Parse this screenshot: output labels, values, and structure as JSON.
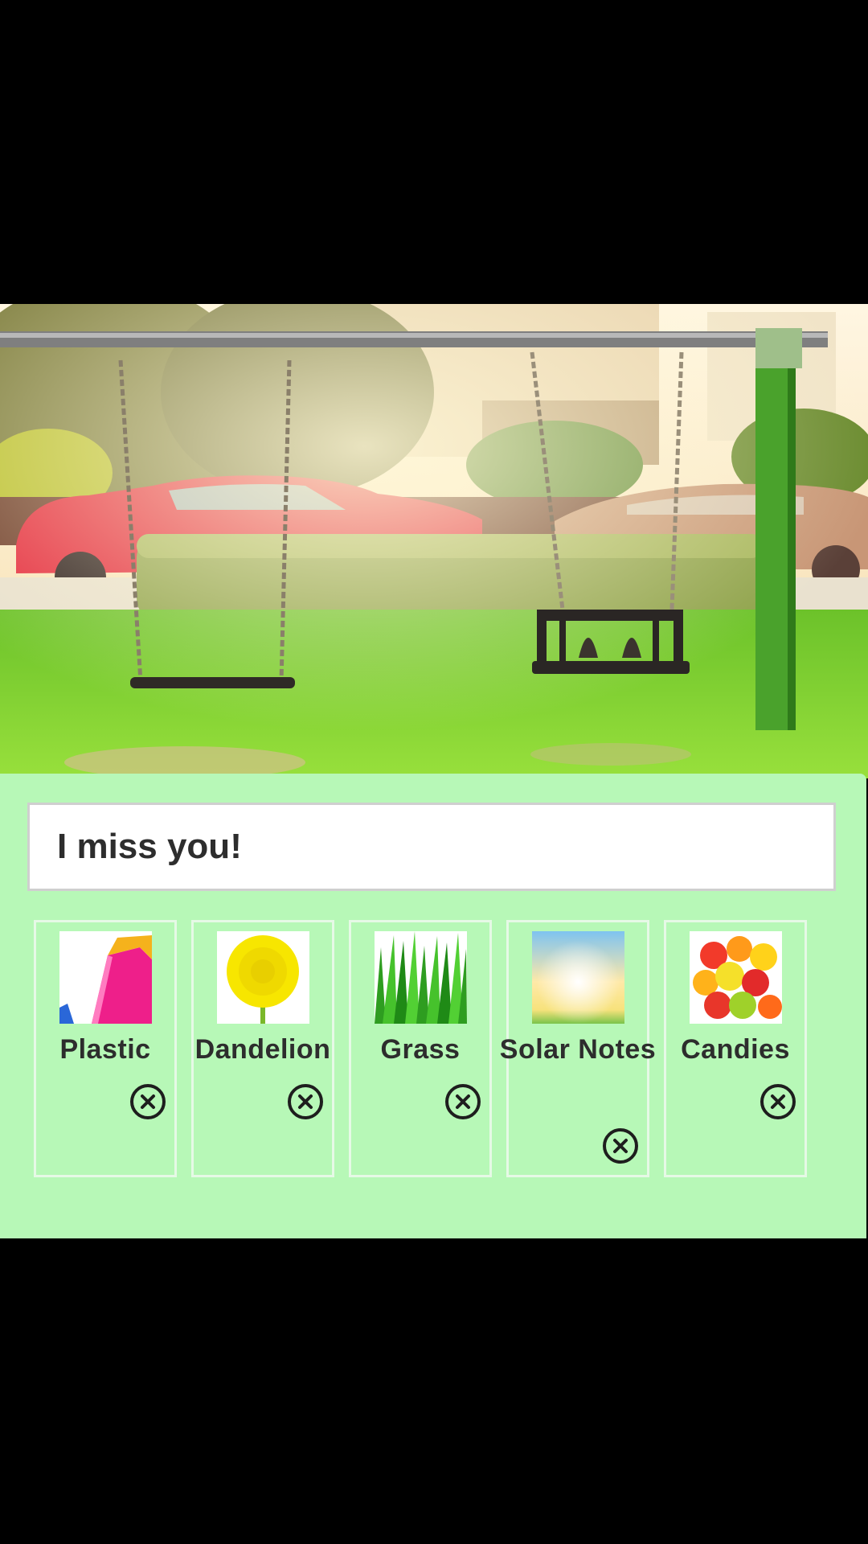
{
  "message": "I miss you!",
  "items": [
    {
      "label": "Plastic",
      "icon": "plastic-image",
      "remove_icon": "remove-circle-x-icon"
    },
    {
      "label": "Dandelion",
      "icon": "dandelion-image",
      "remove_icon": "remove-circle-x-icon"
    },
    {
      "label": "Grass",
      "icon": "grass-image",
      "remove_icon": "remove-circle-x-icon"
    },
    {
      "label": "Solar Notes",
      "icon": "solar-image",
      "remove_icon": "remove-circle-x-icon"
    },
    {
      "label": "Candies",
      "icon": "candies-image",
      "remove_icon": "remove-circle-x-icon"
    }
  ],
  "colors": {
    "panel_bg": "#b7f8b7",
    "background": "#000000",
    "text": "#2d2d2d"
  }
}
